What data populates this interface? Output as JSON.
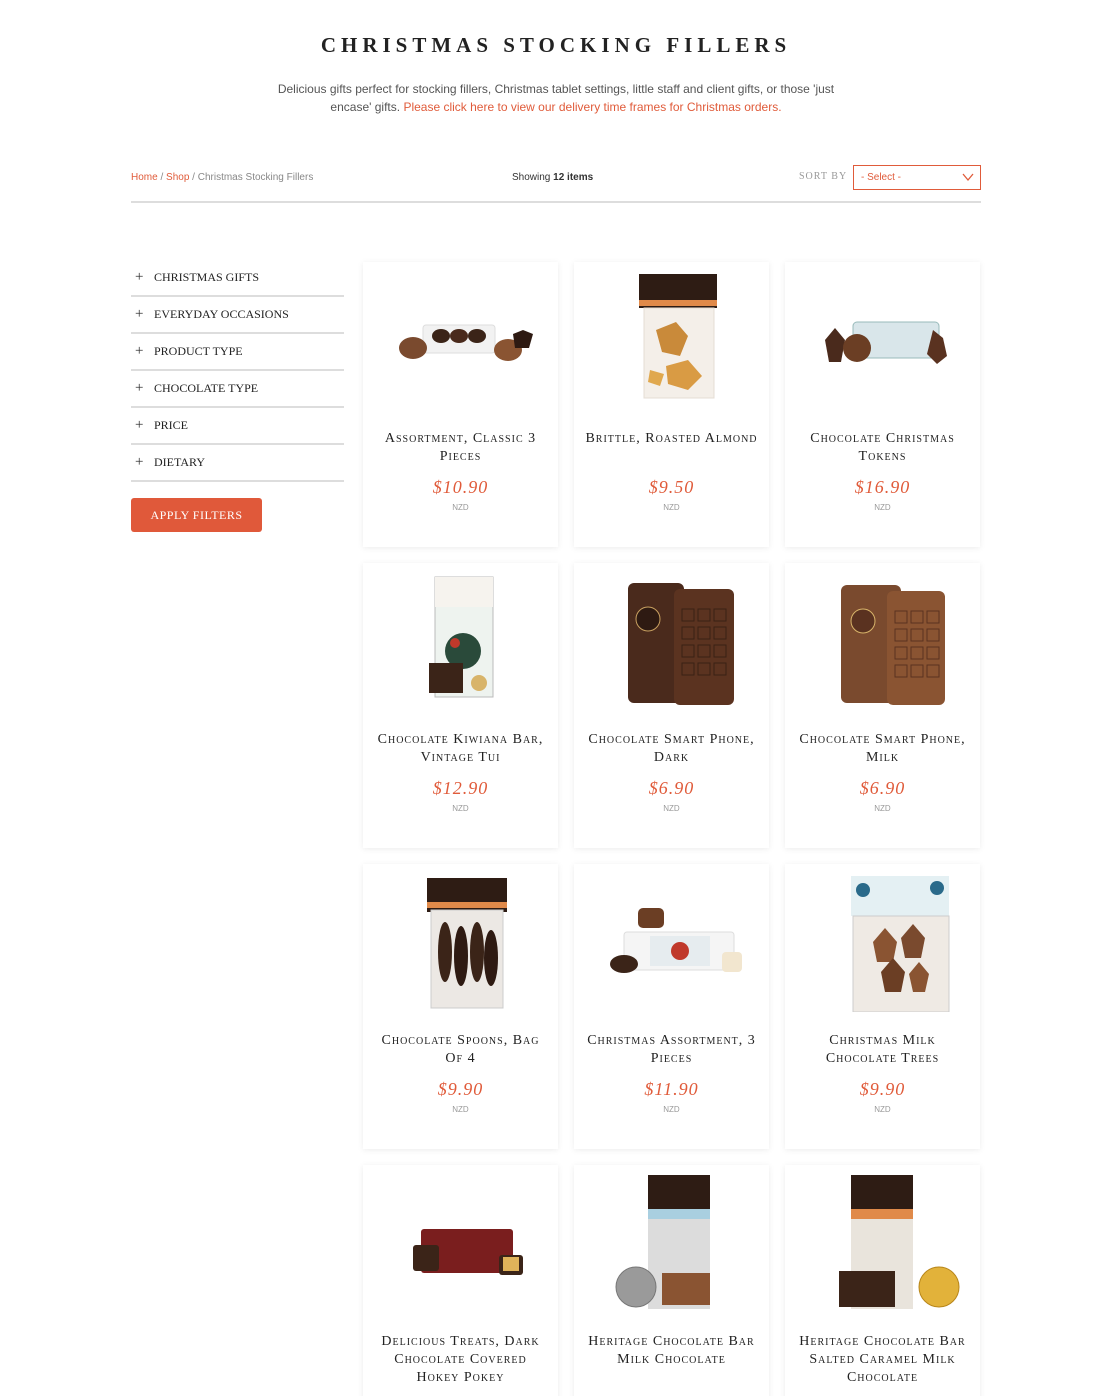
{
  "header": {
    "title": "CHRISTMAS STOCKING FILLERS",
    "intro_text": "Delicious gifts perfect for stocking fillers, Christmas tablet settings, little staff and client gifts, or those 'just encase' gifts.",
    "intro_link": "Please click here to view our delivery time frames for Christmas orders."
  },
  "toolbar": {
    "breadcrumb": {
      "home": "Home",
      "shop": "Shop",
      "current": "Christmas Stocking Fillers",
      "sep": "/"
    },
    "showing_prefix": "Showing",
    "showing_count": "12 items",
    "sort_label": "SORT BY",
    "sort_value": "- Select -"
  },
  "filters": {
    "items": [
      {
        "label": "CHRISTMAS GIFTS"
      },
      {
        "label": "EVERYDAY OCCASIONS"
      },
      {
        "label": "PRODUCT TYPE"
      },
      {
        "label": "CHOCOLATE TYPE"
      },
      {
        "label": "PRICE"
      },
      {
        "label": "DIETARY"
      }
    ],
    "apply_label": "APPLY FILTERS"
  },
  "products": [
    {
      "name": "Assortment, Classic 3 Pieces",
      "price": "$10.90",
      "currency": "NZD"
    },
    {
      "name": "Brittle, Roasted Almond",
      "price": "$9.50",
      "currency": "NZD"
    },
    {
      "name": "Chocolate Christmas Tokens",
      "price": "$16.90",
      "currency": "NZD"
    },
    {
      "name": "Chocolate Kiwiana Bar, Vintage Tui",
      "price": "$12.90",
      "currency": "NZD"
    },
    {
      "name": "Chocolate Smart Phone, Dark",
      "price": "$6.90",
      "currency": "NZD"
    },
    {
      "name": "Chocolate Smart Phone, Milk",
      "price": "$6.90",
      "currency": "NZD"
    },
    {
      "name": "Chocolate Spoons, Bag Of 4",
      "price": "$9.90",
      "currency": "NZD"
    },
    {
      "name": "Christmas Assortment, 3 Pieces",
      "price": "$11.90",
      "currency": "NZD"
    },
    {
      "name": "Christmas Milk Chocolate Trees",
      "price": "$9.90",
      "currency": "NZD"
    },
    {
      "name": "Delicious Treats, Dark Chocolate Covered Hokey Pokey",
      "price": "",
      "currency": ""
    },
    {
      "name": "Heritage Chocolate Bar Milk Chocolate",
      "price": "",
      "currency": ""
    },
    {
      "name": "Heritage Chocolate Bar Salted Caramel Milk Chocolate",
      "price": "",
      "currency": ""
    }
  ],
  "colors": {
    "accent": "#e05b3a",
    "chocolate_dark": "#4a2a1c",
    "chocolate_milk": "#7a4a2e"
  }
}
